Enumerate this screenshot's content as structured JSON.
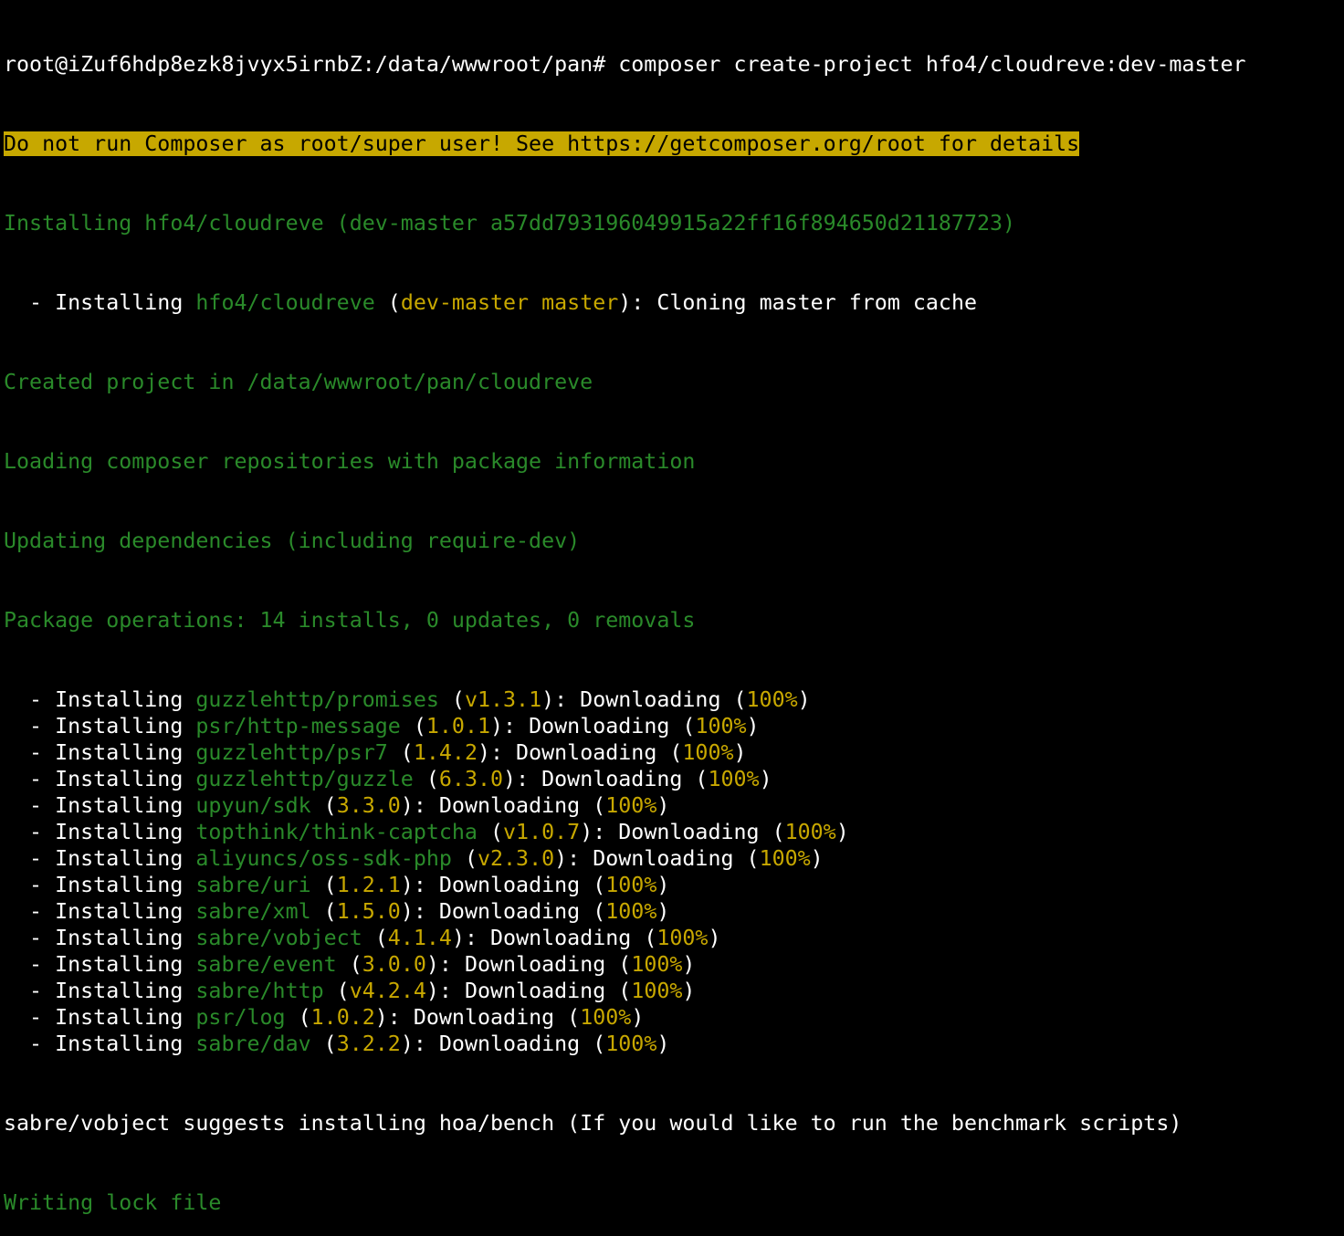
{
  "colors": {
    "background": "#000000",
    "default_text": "#ffffff",
    "green": "#2a8a2a",
    "yellow": "#c8a800",
    "warning_bg": "#c7a800",
    "warning_text": "#000000"
  },
  "terminal": {
    "prompt": "root@iZuf6hdp8ezk8jvyx5irnbZ:/data/wwwroot/pan#",
    "command": " composer create-project hfo4/cloudreve:dev-master",
    "warning": "Do not run Composer as root/super user! See https://getcomposer.org/root for details",
    "installing_project": "Installing hfo4/cloudreve (dev-master a57dd793196049915a22ff16f894650d21187723)",
    "clone_line": {
      "prefix": "  - Installing ",
      "package": "hfo4/cloudreve",
      "open": " (",
      "version": "dev-master master",
      "suffix": "): Cloning master from cache"
    },
    "created_project": "Created project in /data/wwwroot/pan/cloudreve",
    "loading_repos": "Loading composer repositories with package information",
    "updating_deps": "Updating dependencies (including require-dev)",
    "package_ops": "Package operations: 14 installs, 0 updates, 0 removals",
    "install_prefix": "  - Installing ",
    "downloading_text": "): Downloading (",
    "percent": "100%",
    "close_paren": ")",
    "packages": [
      {
        "name": "guzzlehttp/promises",
        "version": "v1.3.1"
      },
      {
        "name": "psr/http-message",
        "version": "1.0.1"
      },
      {
        "name": "guzzlehttp/psr7",
        "version": "1.4.2"
      },
      {
        "name": "guzzlehttp/guzzle",
        "version": "6.3.0"
      },
      {
        "name": "upyun/sdk",
        "version": "3.3.0"
      },
      {
        "name": "topthink/think-captcha",
        "version": "v1.0.7"
      },
      {
        "name": "aliyuncs/oss-sdk-php",
        "version": "v2.3.0"
      },
      {
        "name": "sabre/uri",
        "version": "1.2.1"
      },
      {
        "name": "sabre/xml",
        "version": "1.5.0"
      },
      {
        "name": "sabre/vobject",
        "version": "4.1.4"
      },
      {
        "name": "sabre/event",
        "version": "3.0.0"
      },
      {
        "name": "sabre/http",
        "version": "v4.2.4"
      },
      {
        "name": "psr/log",
        "version": "1.0.2"
      },
      {
        "name": "sabre/dav",
        "version": "3.2.2"
      }
    ],
    "suggests_line": "sabre/vobject suggests installing hoa/bench (If you would like to run the benchmark scripts)",
    "writing_lock": "Writing lock file"
  }
}
